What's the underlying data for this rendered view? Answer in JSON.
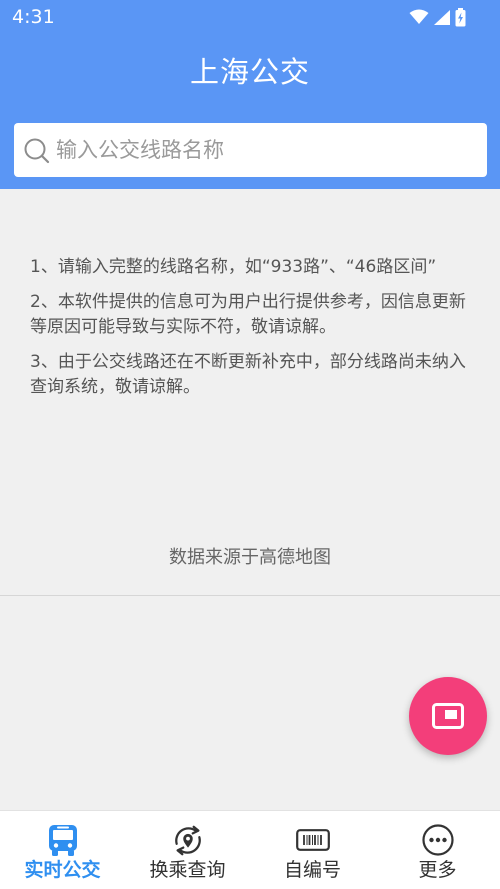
{
  "status_bar": {
    "time": "4:31"
  },
  "header": {
    "title": "上海公交"
  },
  "search": {
    "placeholder": "输入公交线路名称",
    "value": ""
  },
  "tips": [
    "1、请输入完整的线路名称，如“933路”、“46路区间”",
    "2、本软件提供的信息可为用户出行提供参考，因信息更新等原因可能导致与实际不符，敬请谅解。",
    "3、由于公交线路还在不断更新补充中，部分线路尚未纳入查询系统，敬请谅解。"
  ],
  "source": "数据来源于高德地图",
  "bottom_nav": {
    "items": [
      {
        "label": "实时公交",
        "icon": "bus-icon",
        "active": true
      },
      {
        "label": "换乘查询",
        "icon": "transfer-location-icon",
        "active": false
      },
      {
        "label": "自编号",
        "icon": "ticket-icon",
        "active": false
      },
      {
        "label": "更多",
        "icon": "more-icon",
        "active": false
      }
    ]
  },
  "colors": {
    "header_bg": "#5a96f5",
    "fab_bg": "#f33e7a",
    "active_tab": "#2f8ff0",
    "page_bg": "#f0f0f0"
  }
}
